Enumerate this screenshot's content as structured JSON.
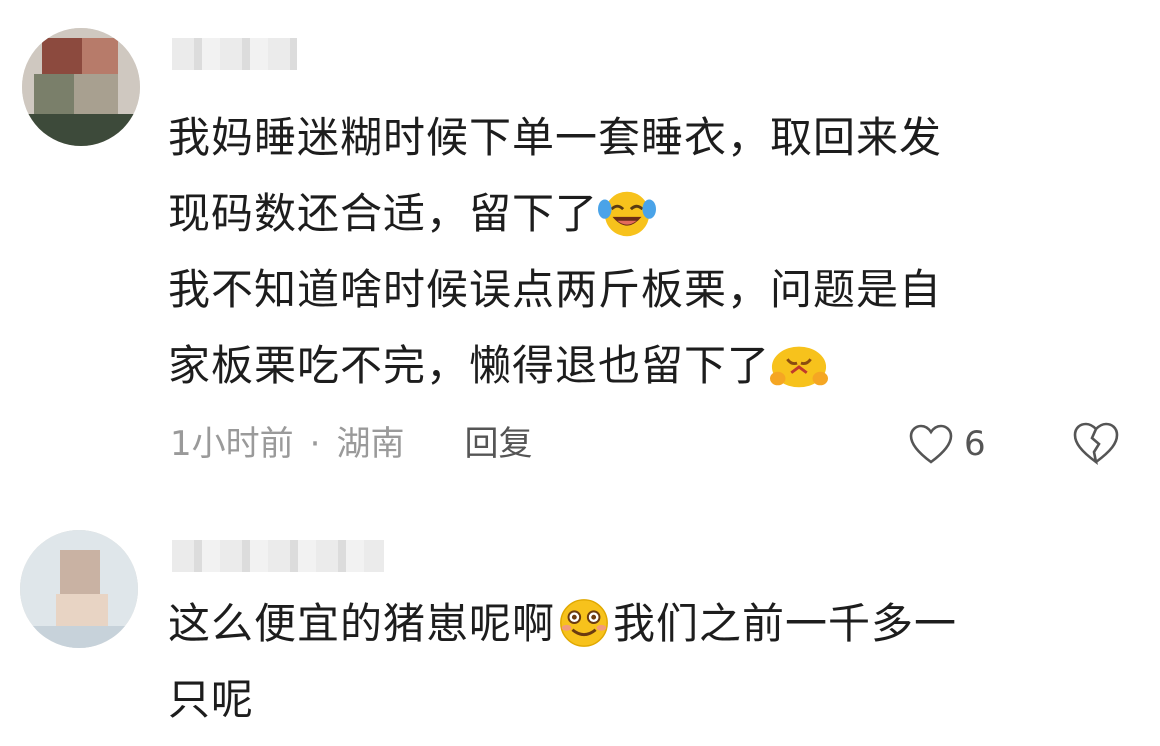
{
  "comments": [
    {
      "text_parts": [
        "我妈睡迷糊时候下单一套睡衣，取回来发\n现码数还合适，留下了",
        "\n我不知道啥时候误点两斤板栗，问题是自\n家板栗吃不完，懒得退也留下了"
      ],
      "emojis": [
        "laughing-crying-emoji",
        "covering-face-emoji"
      ],
      "time": "1小时前",
      "separator": "·",
      "location": "湖南",
      "reply_label": "回复",
      "like_count": "6"
    },
    {
      "text_parts": [
        "这么便宜的猪崽呢啊",
        "我们之前一千多一\n只呢"
      ],
      "emojis": [
        "smiling-emoji"
      ]
    }
  ],
  "colors": {
    "text": "#1d1d1d",
    "meta": "#9a9a9a",
    "reply": "#555555",
    "emoji_yellow": "#f7c21c"
  }
}
